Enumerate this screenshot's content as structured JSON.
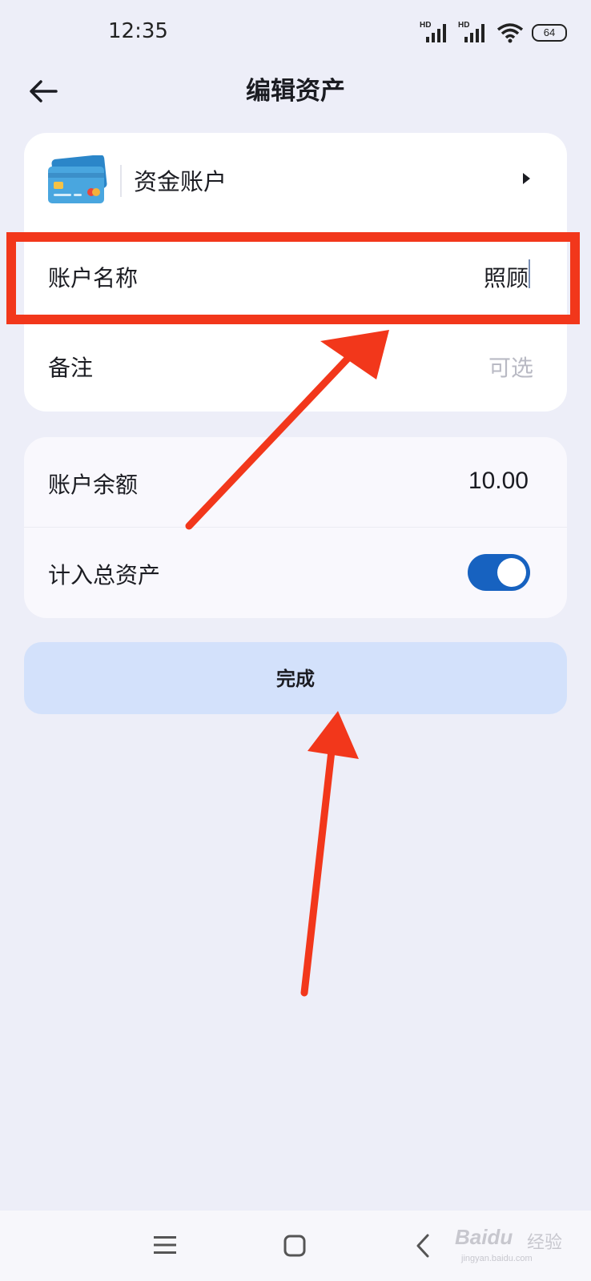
{
  "status_bar": {
    "time": "12:35",
    "network_1": "HD",
    "network_2": "HD",
    "battery": "64"
  },
  "header": {
    "title": "编辑资产",
    "back_icon": "arrow-left-icon"
  },
  "account_type": {
    "label": "资金账户",
    "icon": "credit-card-icon"
  },
  "fields": {
    "name_label": "账户名称",
    "name_value": "照顾",
    "note_label": "备注",
    "note_placeholder": "可选",
    "balance_label": "账户余额",
    "balance_value": "10.00",
    "include_total_label": "计入总资产",
    "include_total_on": true
  },
  "actions": {
    "done_label": "完成"
  },
  "nav": {
    "menu_icon": "menu-icon",
    "home_icon": "home-square-icon",
    "back_icon": "chevron-left-icon"
  },
  "watermark": {
    "logo": "Baidu",
    "text": "经验",
    "url": "jingyan.baidu.com"
  },
  "colors": {
    "background": "#edeef8",
    "accent": "#1762c0",
    "button_bg": "#d3e1fb",
    "annotation": "#f2371b"
  }
}
